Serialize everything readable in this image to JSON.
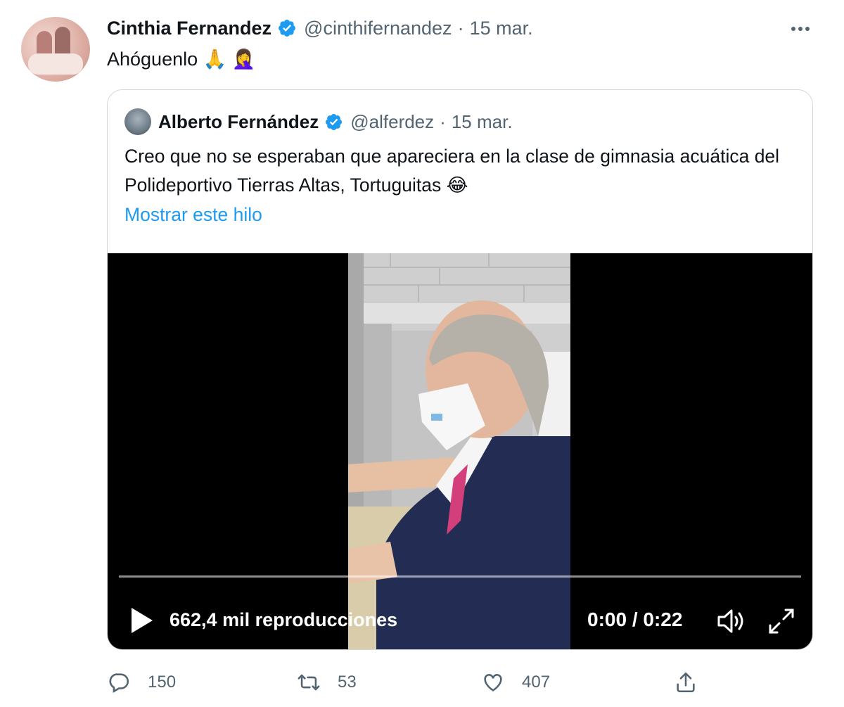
{
  "tweet": {
    "author_name": "Cinthia Fernandez",
    "author_handle": "@cinthifernandez",
    "separator": "·",
    "date": "15 mar.",
    "text": "Ahóguenlo 🙏 🤦‍♀️"
  },
  "quoted": {
    "author_name": "Alberto Fernández",
    "author_handle": "@alferdez",
    "separator": "·",
    "date": "15 mar.",
    "text": "Creo que no se esperaban que apareciera en la clase de gimnasia acuática del Polideportivo Tierras Altas, Tortuguitas 😂",
    "show_thread": "Mostrar este hilo",
    "video": {
      "views": "662,4 mil reproducciones",
      "time": "0:00 / 0:22",
      "progress": 0
    }
  },
  "actions": {
    "replies": "150",
    "retweets": "53",
    "likes": "407"
  },
  "colors": {
    "accent": "#1d9bf0",
    "muted": "#536471",
    "border": "#cfd9de"
  },
  "icons": [
    "verified-badge-icon",
    "more-icon",
    "play-icon",
    "volume-icon",
    "fullscreen-icon",
    "reply-icon",
    "retweet-icon",
    "like-icon",
    "share-icon"
  ]
}
